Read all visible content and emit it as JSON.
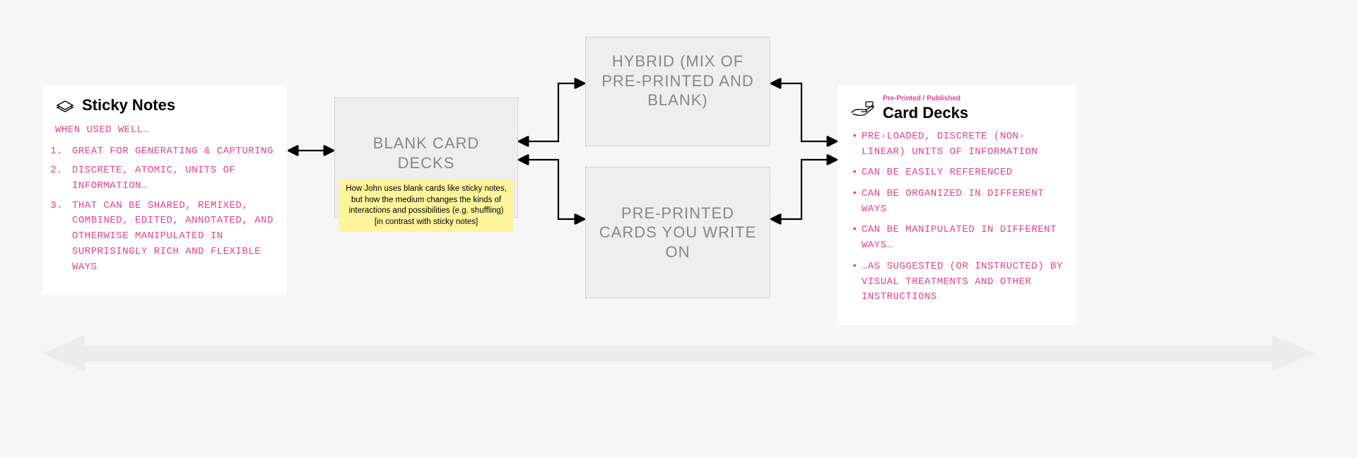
{
  "left": {
    "title": "Sticky Notes",
    "lead": "WHEN USED WELL…",
    "items": [
      "GREAT FOR GENERATING & CAPTURING",
      "DISCRETE, ATOMIC, UNITS OF INFORMATION…",
      "THAT CAN BE SHARED, REMIXED, COMBINED, EDITED, ANNOTATED, AND OTHERWISE MANIPULATED IN SURPRISINGLY RICH AND FLEXIBLE WAYS"
    ]
  },
  "middle": {
    "blank": {
      "title": "BLANK CARD DECKS",
      "note": "How John uses blank cards like sticky notes, but how the medium changes the kinds of interactions and possibilities (e.g. shuffling) [in contrast with sticky notes]"
    },
    "hybrid": "HYBRID (MIX OF PRE-PRINTED AND BLANK)",
    "preprinted": "PRE-PRINTED CARDS YOU WRITE ON"
  },
  "right": {
    "super": "Pre-Printed / Published",
    "title": "Card Decks",
    "items": [
      "PRE-LOADED, DISCRETE (NON-LINEAR) UNITS OF INFORMATION",
      "CAN BE EASILY REFERENCED",
      "CAN BE ORGANIZED IN DIFFERENT WAYS",
      "CAN BE MANIPULATED IN DIFFERENT WAYS…",
      "…AS SUGGESTED (OR INSTRUCTED) BY VISUAL TREATMENTS AND OTHER INSTRUCTIONS"
    ]
  }
}
